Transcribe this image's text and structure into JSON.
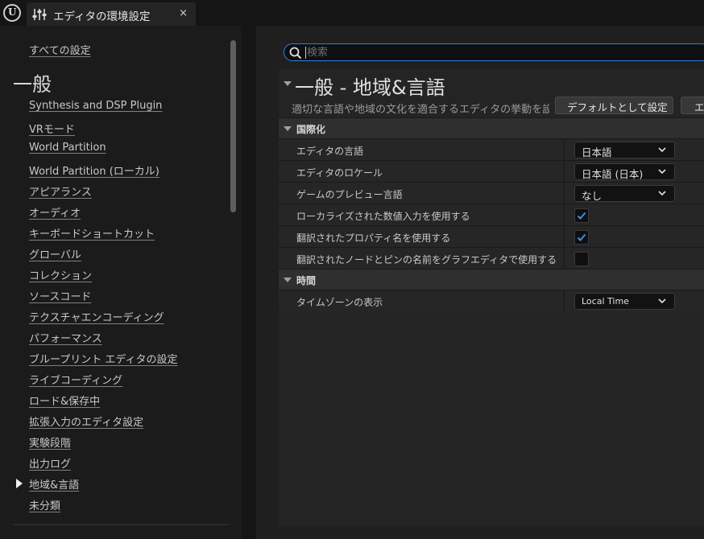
{
  "window": {
    "logo_text": "U",
    "tab_title": "エディタの環境設定",
    "tab_close": "×"
  },
  "sidebar": {
    "all_settings": "すべての設定",
    "header": "一般",
    "items": [
      {
        "label": "Synthesis and DSP Plugin"
      },
      {
        "label": "VRモード"
      },
      {
        "label": "World Partition"
      },
      {
        "label": "World Partition (ローカル)"
      },
      {
        "label": "アピアランス"
      },
      {
        "label": "オーディオ"
      },
      {
        "label": "キーボードショートカット"
      },
      {
        "label": "グローバル"
      },
      {
        "label": "コレクション"
      },
      {
        "label": "ソースコード"
      },
      {
        "label": "テクスチャエンコーディング"
      },
      {
        "label": "パフォーマンス"
      },
      {
        "label": "ブループリント エディタの設定"
      },
      {
        "label": "ライブコーディング"
      },
      {
        "label": "ロード&保存中"
      },
      {
        "label": "拡張入力のエディタ設定"
      },
      {
        "label": "実験段階"
      },
      {
        "label": "出力ログ"
      },
      {
        "label": "地域&言語",
        "selected": true
      },
      {
        "label": "未分類"
      }
    ]
  },
  "search": {
    "placeholder": "検索",
    "value": ""
  },
  "page": {
    "title": "一般 - 地域&言語",
    "description": "適切な言語や地域の文化を適合するエディタの挙動を設",
    "buttons": {
      "set_default": "デフォルトとして設定",
      "export": "エクスポート"
    }
  },
  "sections": [
    {
      "label": "国際化",
      "rows": [
        {
          "label": "エディタの言語",
          "type": "dropdown",
          "value": "日本語"
        },
        {
          "label": "エディタのロケール",
          "type": "dropdown",
          "value": "日本語 (日本)"
        },
        {
          "label": "ゲームのプレビュー言語",
          "type": "dropdown",
          "value": "なし"
        },
        {
          "label": "ローカライズされた数値入力を使用する",
          "type": "checkbox",
          "checked": true
        },
        {
          "label": "翻訳されたプロパティ名を使用する",
          "type": "checkbox",
          "checked": true
        },
        {
          "label": "翻訳されたノードとピンの名前をグラフエディタで使用する",
          "type": "checkbox",
          "checked": false
        }
      ]
    },
    {
      "label": "時間",
      "rows": [
        {
          "label": "タイムゾーンの表示",
          "type": "dropdown",
          "value": "Local Time"
        }
      ]
    }
  ],
  "colors": {
    "accent_blue": "#2d7ee0",
    "check_blue": "#3a8ff0",
    "background": "#151515",
    "panel": "#242424"
  }
}
